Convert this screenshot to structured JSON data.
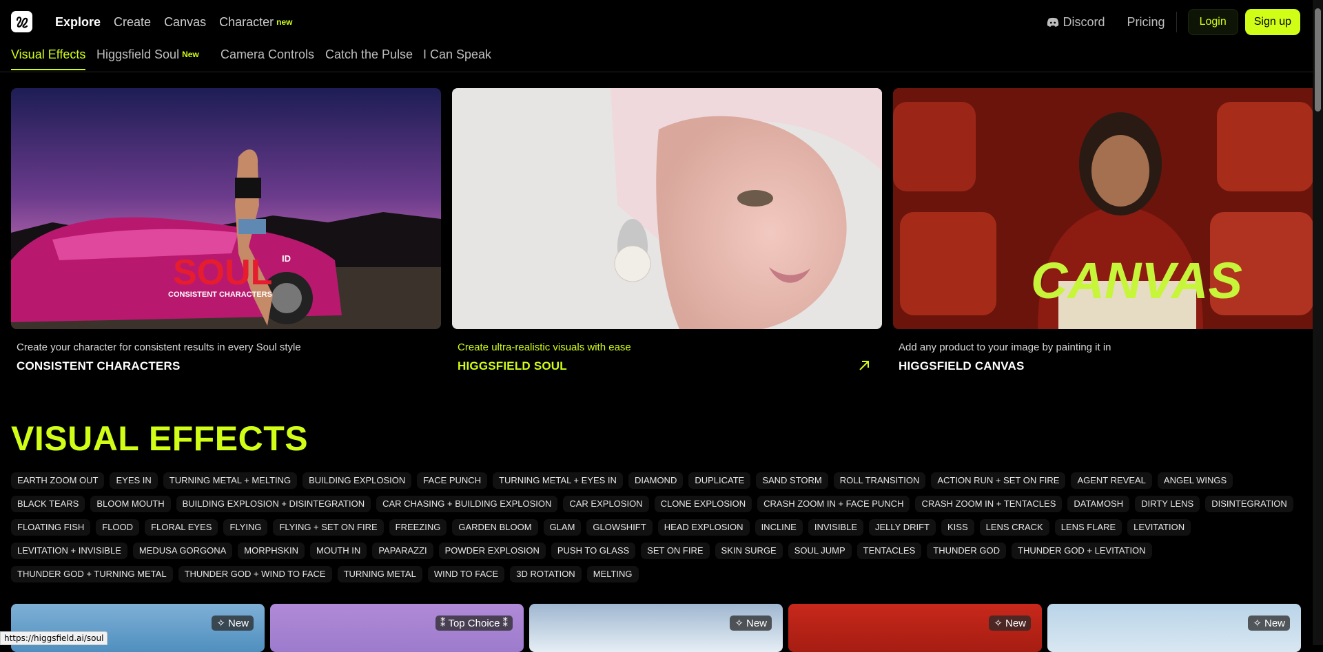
{
  "nav": {
    "items": [
      "Explore",
      "Create",
      "Canvas",
      "Character"
    ],
    "character_badge": "new",
    "discord": "Discord",
    "pricing": "Pricing",
    "login": "Login",
    "signup": "Sign up"
  },
  "tabs": [
    "Visual Effects",
    "Higgsfield Soul",
    "Camera Controls",
    "Catch the Pulse",
    "I Can Speak"
  ],
  "tab_soul_badge": "New",
  "hero": [
    {
      "subtitle": "Create your character for consistent results in every Soul style",
      "title": "CONSISTENT CHARACTERS",
      "overlay_logo": "SOUL",
      "overlay_id": "ID",
      "overlay_caption": "CONSISTENT CHARACTERS"
    },
    {
      "subtitle": "Create ultra-realistic visuals with ease",
      "title": "HIGGSFIELD SOUL"
    },
    {
      "subtitle": "Add any product to your image by painting it in",
      "title": "HIGGSFIELD CANVAS",
      "overlay_logo": "CANVAS"
    }
  ],
  "visual_effects": {
    "title": "VISUAL EFFECTS",
    "chips": [
      "EARTH ZOOM OUT",
      "EYES IN",
      "TURNING METAL + MELTING",
      "BUILDING EXPLOSION",
      "FACE PUNCH",
      "TURNING METAL + EYES IN",
      "DIAMOND",
      "DUPLICATE",
      "SAND STORM",
      "ROLL TRANSITION",
      "ACTION RUN + SET ON FIRE",
      "AGENT REVEAL",
      "ANGEL WINGS",
      "BLACK TEARS",
      "BLOOM MOUTH",
      "BUILDING EXPLOSION + DISINTEGRATION",
      "CAR CHASING + BUILDING EXPLOSION",
      "CAR EXPLOSION",
      "CLONE EXPLOSION",
      "CRASH ZOOM IN + FACE PUNCH",
      "CRASH ZOOM IN + TENTACLES",
      "DATAMOSH",
      "DIRTY LENS",
      "DISINTEGRATION",
      "FLOATING FISH",
      "FLOOD",
      "FLORAL EYES",
      "FLYING",
      "FLYING + SET ON FIRE",
      "FREEZING",
      "GARDEN BLOOM",
      "GLAM",
      "GLOWSHIFT",
      "HEAD EXPLOSION",
      "INCLINE",
      "INVISIBLE",
      "JELLY DRIFT",
      "KISS",
      "LENS CRACK",
      "LENS FLARE",
      "LEVITATION",
      "LEVITATION + INVISIBLE",
      "MEDUSA GORGONA",
      "MORPHSKIN",
      "MOUTH IN",
      "PAPARAZZI",
      "POWDER EXPLOSION",
      "PUSH TO GLASS",
      "SET ON FIRE",
      "SKIN SURGE",
      "SOUL JUMP",
      "TENTACLES",
      "THUNDER GOD",
      "THUNDER GOD + LEVITATION",
      "THUNDER GOD + TURNING METAL",
      "THUNDER GOD + WIND TO FACE",
      "TURNING METAL",
      "WIND TO FACE",
      "3D ROTATION",
      "MELTING"
    ]
  },
  "cards": [
    {
      "badge": "New"
    },
    {
      "badge": "Top Choice"
    },
    {
      "badge": "New"
    },
    {
      "badge": "New"
    },
    {
      "badge": "New"
    }
  ],
  "status_url": "https://higgsfield.ai/soul",
  "colors": {
    "accent": "#d1fe17",
    "background": "#000000"
  }
}
